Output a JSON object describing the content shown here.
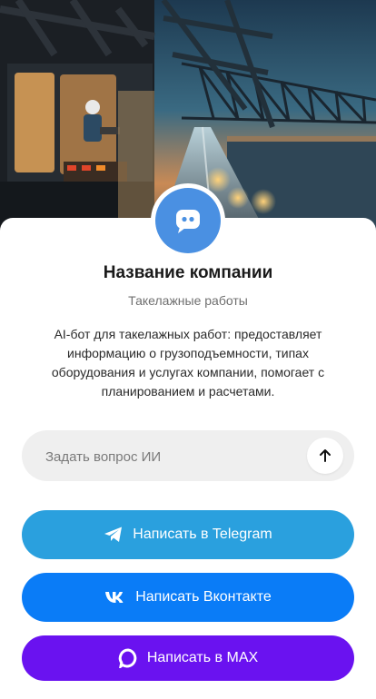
{
  "company": {
    "name": "Название компании",
    "subtitle": "Такелажные работы",
    "description": "AI-бот для такелажных работ: предоставляет информацию о грузоподъемности, типах оборудования и услугах компании, помогает с планированием и расчетами."
  },
  "ask": {
    "placeholder": "Задать вопрос ИИ"
  },
  "buttons": {
    "telegram": "Написать в Telegram",
    "vk": "Написать Вконтакте",
    "max": "Написать в MAX"
  },
  "colors": {
    "avatar": "#4a90e2",
    "telegram": "#2aa0de",
    "vk": "#0a7cf7",
    "max": "#6a12f0",
    "ask_bg": "#efefef"
  },
  "icons": {
    "avatar": "chat-bot-icon",
    "send": "arrow-up-icon",
    "telegram": "telegram-icon",
    "vk": "vk-icon",
    "max": "max-icon"
  }
}
